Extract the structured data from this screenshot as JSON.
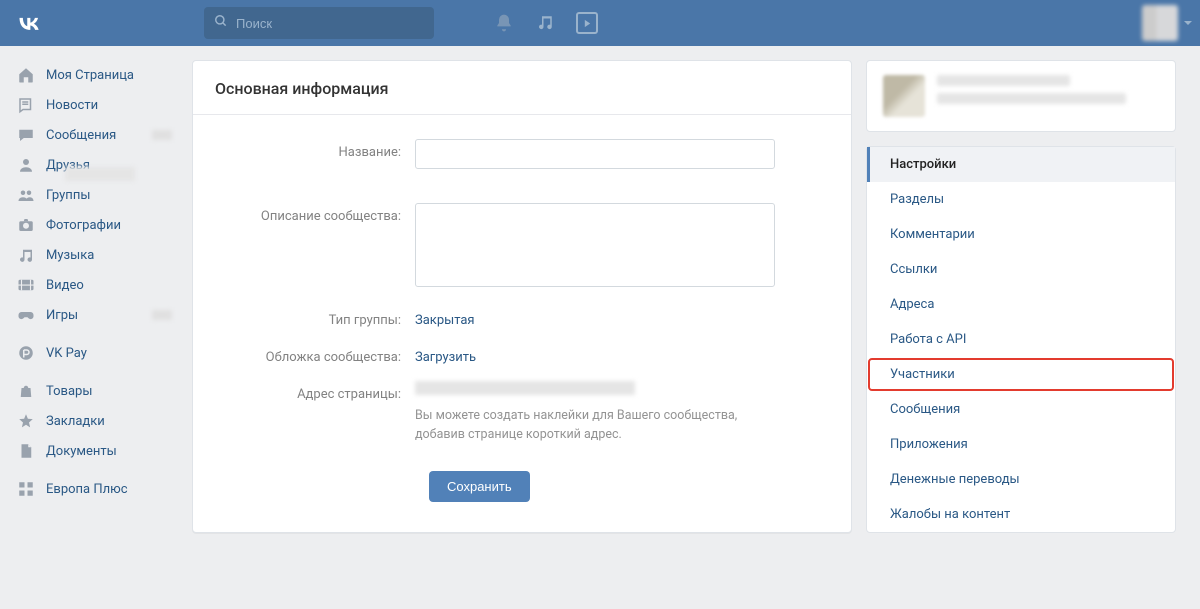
{
  "search": {
    "placeholder": "Поиск"
  },
  "nav": {
    "items": [
      {
        "key": "profile",
        "label": "Моя Страница",
        "icon": "home"
      },
      {
        "key": "news",
        "label": "Новости",
        "icon": "news"
      },
      {
        "key": "messages",
        "label": "Сообщения",
        "icon": "msg",
        "blur": true
      },
      {
        "key": "friends",
        "label": "Друзья",
        "icon": "friend"
      },
      {
        "key": "groups",
        "label": "Группы",
        "icon": "groups"
      },
      {
        "key": "photos",
        "label": "Фотографии",
        "icon": "camera"
      },
      {
        "key": "music",
        "label": "Музыка",
        "icon": "music"
      },
      {
        "key": "video",
        "label": "Видео",
        "icon": "video"
      },
      {
        "key": "games",
        "label": "Игры",
        "icon": "game",
        "blur": true
      }
    ],
    "block2": [
      {
        "key": "vkpay",
        "label": "VK Pay",
        "icon": "pay"
      }
    ],
    "block3": [
      {
        "key": "market",
        "label": "Товары",
        "icon": "bag"
      },
      {
        "key": "bookmarks",
        "label": "Закладки",
        "icon": "star"
      },
      {
        "key": "docs",
        "label": "Документы",
        "icon": "doc"
      }
    ],
    "block4": [
      {
        "key": "europa",
        "label": "Европа Плюс",
        "icon": "apps"
      }
    ]
  },
  "main": {
    "title": "Основная информация",
    "form": {
      "name_label": "Название:",
      "desc_label": "Описание сообщества:",
      "type_label": "Тип группы:",
      "type_value": "Закрытая",
      "cover_label": "Обложка сообщества:",
      "cover_value": "Загрузить",
      "addr_label": "Адрес страницы:",
      "addr_hint": "Вы можете создать наклейки для Вашего сообщества, добавив странице короткий адрес.",
      "save": "Сохранить"
    }
  },
  "right_menu": {
    "items": [
      {
        "label": "Настройки",
        "active": true
      },
      {
        "label": "Разделы"
      },
      {
        "label": "Комментарии"
      },
      {
        "label": "Ссылки"
      },
      {
        "label": "Адреса"
      },
      {
        "label": "Работа с API"
      },
      {
        "label": "Участники",
        "highlight": true
      },
      {
        "label": "Сообщения"
      },
      {
        "label": "Приложения"
      },
      {
        "label": "Денежные переводы"
      },
      {
        "label": "Жалобы на контент"
      }
    ]
  }
}
